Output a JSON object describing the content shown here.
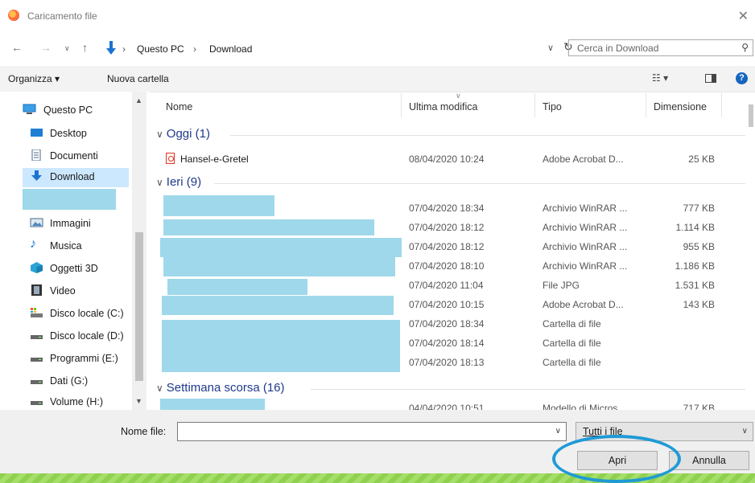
{
  "window": {
    "title": "Caricamento file"
  },
  "address": {
    "crumbs": [
      "Questo PC",
      "Download"
    ],
    "search_placeholder": "Cerca in Download"
  },
  "toolbar": {
    "organize": "Organizza ▾",
    "new_folder": "Nuova cartella"
  },
  "sidebar": {
    "items": [
      {
        "label": "Questo PC",
        "icon": "pc-icon"
      },
      {
        "label": "Desktop",
        "icon": "desktop-icon"
      },
      {
        "label": "Documenti",
        "icon": "documents-icon"
      },
      {
        "label": "Download",
        "icon": "download-icon",
        "selected": true
      },
      {
        "label": "Immagini",
        "icon": "images-icon"
      },
      {
        "label": "Musica",
        "icon": "music-icon"
      },
      {
        "label": "Oggetti 3D",
        "icon": "3d-objects-icon"
      },
      {
        "label": "Video",
        "icon": "video-icon"
      },
      {
        "label": "Disco locale (C:)",
        "icon": "drive-c-icon"
      },
      {
        "label": "Disco locale (D:)",
        "icon": "drive-icon"
      },
      {
        "label": "Programmi (E:)",
        "icon": "drive-icon"
      },
      {
        "label": "Dati (G:)",
        "icon": "drive-icon"
      },
      {
        "label": "Volume (H:)",
        "icon": "drive-icon"
      }
    ]
  },
  "columns": {
    "name": "Nome",
    "modified": "Ultima modifica",
    "type": "Tipo",
    "size": "Dimensione"
  },
  "groups": [
    {
      "label": "Oggi (1)"
    },
    {
      "label": "Ieri (9)"
    },
    {
      "label": "Settimana scorsa (16)"
    }
  ],
  "rows": [
    {
      "name": "Hansel-e-Gretel",
      "date": "08/04/2020 10:24",
      "type": "Adobe Acrobat D...",
      "size": "25 KB"
    },
    {
      "name": "",
      "date": "07/04/2020 18:34",
      "type": "Archivio WinRAR ...",
      "size": "777 KB"
    },
    {
      "name": "",
      "date": "07/04/2020 18:12",
      "type": "Archivio WinRAR ...",
      "size": "1.114 KB"
    },
    {
      "name": "",
      "date": "07/04/2020 18:12",
      "type": "Archivio WinRAR ...",
      "size": "955 KB"
    },
    {
      "name": "",
      "date": "07/04/2020 18:10",
      "type": "Archivio WinRAR ...",
      "size": "1.186 KB"
    },
    {
      "name": "",
      "date": "07/04/2020 11:04",
      "type": "File JPG",
      "size": "1.531 KB"
    },
    {
      "name": "",
      "date": "07/04/2020 10:15",
      "type": "Adobe Acrobat D...",
      "size": "143 KB"
    },
    {
      "name": "",
      "date": "07/04/2020 18:34",
      "type": "Cartella di file",
      "size": ""
    },
    {
      "name": "",
      "date": "07/04/2020 18:14",
      "type": "Cartella di file",
      "size": ""
    },
    {
      "name": "",
      "date": "07/04/2020 18:13",
      "type": "Cartella di file",
      "size": ""
    },
    {
      "name": "",
      "date": "04/04/2020 10:51",
      "type": "Modello di Micros...",
      "size": "717 KB"
    }
  ],
  "bottom": {
    "filename_label": "Nome file:",
    "filename_value": "",
    "filetype": "Tutti i file",
    "open": "Apri",
    "cancel": "Annulla"
  },
  "colors": {
    "accent": "#1f9ad6",
    "selection": "#cce8ff",
    "redaction": "#9fd8ea",
    "group_text": "#1e3a8a"
  }
}
